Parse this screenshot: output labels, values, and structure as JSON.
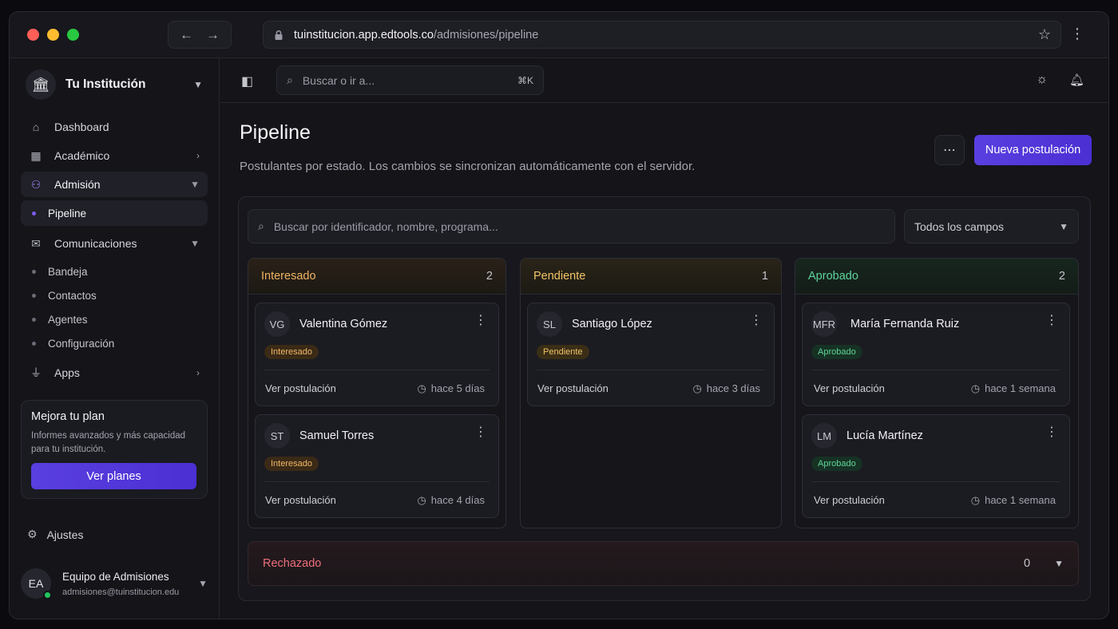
{
  "browser": {
    "url_host": "tuinstitucion.app.edtools.co",
    "url_path": "/admisiones/pipeline",
    "back_icon": "arrow-left-icon",
    "forward_icon": "arrow-right-icon"
  },
  "sidebar": {
    "institution": "Tu Institución",
    "nav": {
      "dashboard": "Dashboard",
      "academico": "Académico",
      "admision": "Admisión",
      "pipeline": "Pipeline",
      "comunicaciones": "Comunicaciones",
      "bandeja": "Bandeja",
      "contactos": "Contactos",
      "agentes": "Agentes",
      "configuracion": "Configuración",
      "apps": "Apps"
    },
    "upgrade": {
      "title": "Mejora tu plan",
      "text": "Informes avanzados y más capacidad para tu institución.",
      "button": "Ver planes"
    },
    "settings": "Ajustes",
    "user": {
      "initials": "EA",
      "name": "Equipo de Admisiones",
      "email": "admisiones@tuinstitucion.edu"
    }
  },
  "topbar": {
    "search_placeholder": "Buscar o ir a...",
    "shortcut": "⌘K"
  },
  "page": {
    "title": "Pipeline",
    "subtitle": "Postulantes por estado. Los cambios se sincronizan automáticamente con el servidor.",
    "new_button": "Nueva postulación",
    "search_placeholder": "Buscar por identificador, nombre, programa...",
    "field_select": "Todos los campos"
  },
  "columns": {
    "interesado": {
      "title": "Interesado",
      "count": "2",
      "cards": [
        {
          "initials": "VG",
          "name": "Valentina Gómez",
          "badge": "Interesado",
          "link": "Ver postulación",
          "time": "hace 5 días"
        },
        {
          "initials": "ST",
          "name": "Samuel Torres",
          "badge": "Interesado",
          "link": "Ver postulación",
          "time": "hace 4 días"
        }
      ]
    },
    "pendiente": {
      "title": "Pendiente",
      "count": "1",
      "cards": [
        {
          "initials": "SL",
          "name": "Santiago López",
          "badge": "Pendiente",
          "link": "Ver postulación",
          "time": "hace 3 días"
        }
      ]
    },
    "aprobado": {
      "title": "Aprobado",
      "count": "2",
      "cards": [
        {
          "initials": "MFR",
          "name": "María Fernanda Ruiz",
          "badge": "Aprobado",
          "link": "Ver postulación",
          "time": "hace 1 semana"
        },
        {
          "initials": "LM",
          "name": "Lucía Martínez",
          "badge": "Aprobado",
          "link": "Ver postulación",
          "time": "hace 1 semana"
        }
      ]
    },
    "rechazado": {
      "title": "Rechazado",
      "count": "0"
    }
  },
  "colors": {
    "accent": "#5a3fe0",
    "interested": "#f0b463",
    "pending": "#f2c468",
    "approved": "#5fd49a",
    "rejected": "#ec6f7a"
  }
}
